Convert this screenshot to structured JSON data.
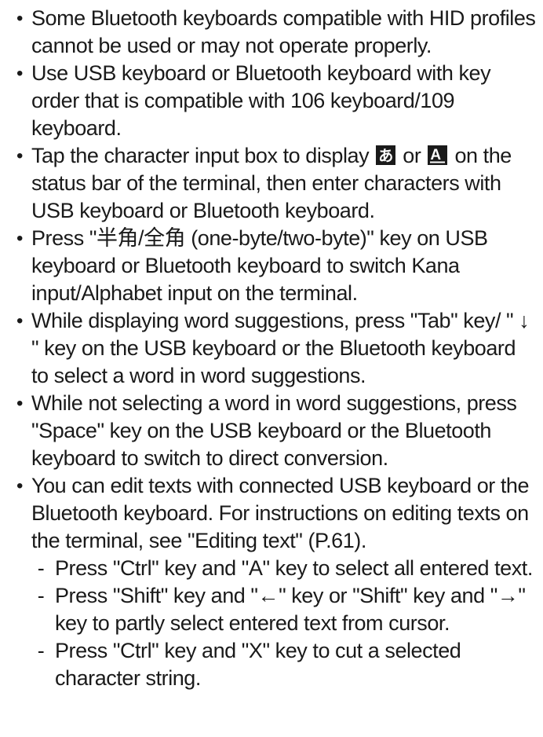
{
  "bullets": [
    {
      "text": "Some Bluetooth keyboards compatible with HID profiles cannot be used or may not operate properly."
    },
    {
      "text": "Use USB keyboard or Bluetooth keyboard with key order that is compatible with 106 keyboard/109 keyboard."
    },
    {
      "text_before": "Tap the character input box to display ",
      "icon_1": "hiragana-a-input-icon",
      "text_middle": " or ",
      "icon_2": "alphabet-a-input-icon",
      "text_after": " on the status bar of the terminal, then enter characters with USB keyboard or Bluetooth keyboard."
    },
    {
      "text": "Press \"半角/全角 (one-byte/two-byte)\" key on USB keyboard or Bluetooth keyboard to switch Kana input/Alphabet input on the terminal."
    },
    {
      "text": "While displaying word suggestions, press \"Tab\" key/ \" ↓ \" key on the USB keyboard or the Bluetooth keyboard to select a word in word suggestions."
    },
    {
      "text": "While not selecting a word in word suggestions, press \"Space\" key on the USB keyboard or the Bluetooth keyboard to switch to direct conversion."
    },
    {
      "text": "You can edit texts with connected USB keyboard or the Bluetooth keyboard. For instructions on editing texts on the terminal, see \"Editing text\" (P.61).",
      "subitems": [
        "Press \"Ctrl\" key and \"A\" key to select all entered text.",
        "Press \"Shift\" key and \"←\" key or \"Shift\" key and \"→\" key to partly select entered text from cursor.",
        "Press \"Ctrl\" key and \"X\" key to cut a selected character string."
      ]
    }
  ],
  "bullet_symbol": "•",
  "dash_symbol": "-",
  "icon_hiragana_glyph": "あ",
  "icon_alpha_glyph": "A"
}
